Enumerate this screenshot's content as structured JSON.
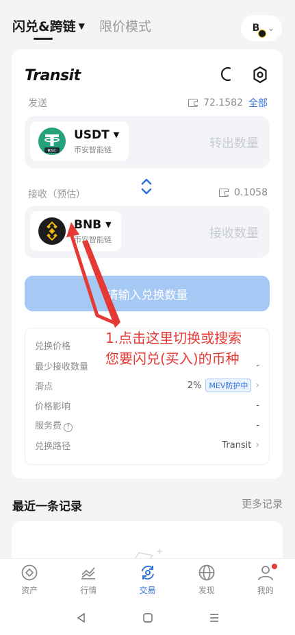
{
  "top_tabs": {
    "flash_swap_label": "闪兑&跨链",
    "limit_mode_label": "限价模式",
    "wallet_initial": "B"
  },
  "swap": {
    "brand": "Transit",
    "send_label": "发送",
    "send_balance": "72.1582",
    "all_label": "全部",
    "send_token": {
      "symbol": "USDT",
      "chain": "币安智能链",
      "badge": "BSC"
    },
    "send_placeholder": "转出数量",
    "receive_label": "接收（预估）",
    "receive_balance": "0.1058",
    "receive_token": {
      "symbol": "BNB",
      "chain": "币安智能链"
    },
    "receive_placeholder": "接收数量",
    "submit_label": "请输入兑换数量"
  },
  "details": {
    "rows": [
      {
        "label": "兑换价格",
        "value": ""
      },
      {
        "label": "最少接收数量",
        "value": "-"
      },
      {
        "label": "滑点",
        "value": "2%",
        "badge": "MEV防护中"
      },
      {
        "label": "价格影响",
        "value": "-"
      },
      {
        "label": "服务费",
        "value": "-"
      },
      {
        "label": "兑换路径",
        "value": "Transit"
      }
    ]
  },
  "annotation": {
    "line1": "1.点击这里切换或搜索",
    "line2": "您要闪兑(买入)的币种"
  },
  "recent": {
    "title": "最近一条记录",
    "more_label": "更多记录"
  },
  "bottom_nav": {
    "items": [
      {
        "label": "资产"
      },
      {
        "label": "行情"
      },
      {
        "label": "交易"
      },
      {
        "label": "发现"
      },
      {
        "label": "我的"
      }
    ]
  },
  "colors": {
    "accent": "#2f72d9",
    "button_disabled": "#a6c8f4",
    "annotation": "#e53935",
    "usdt": "#26a17b",
    "bnb": "#f0b90b"
  }
}
